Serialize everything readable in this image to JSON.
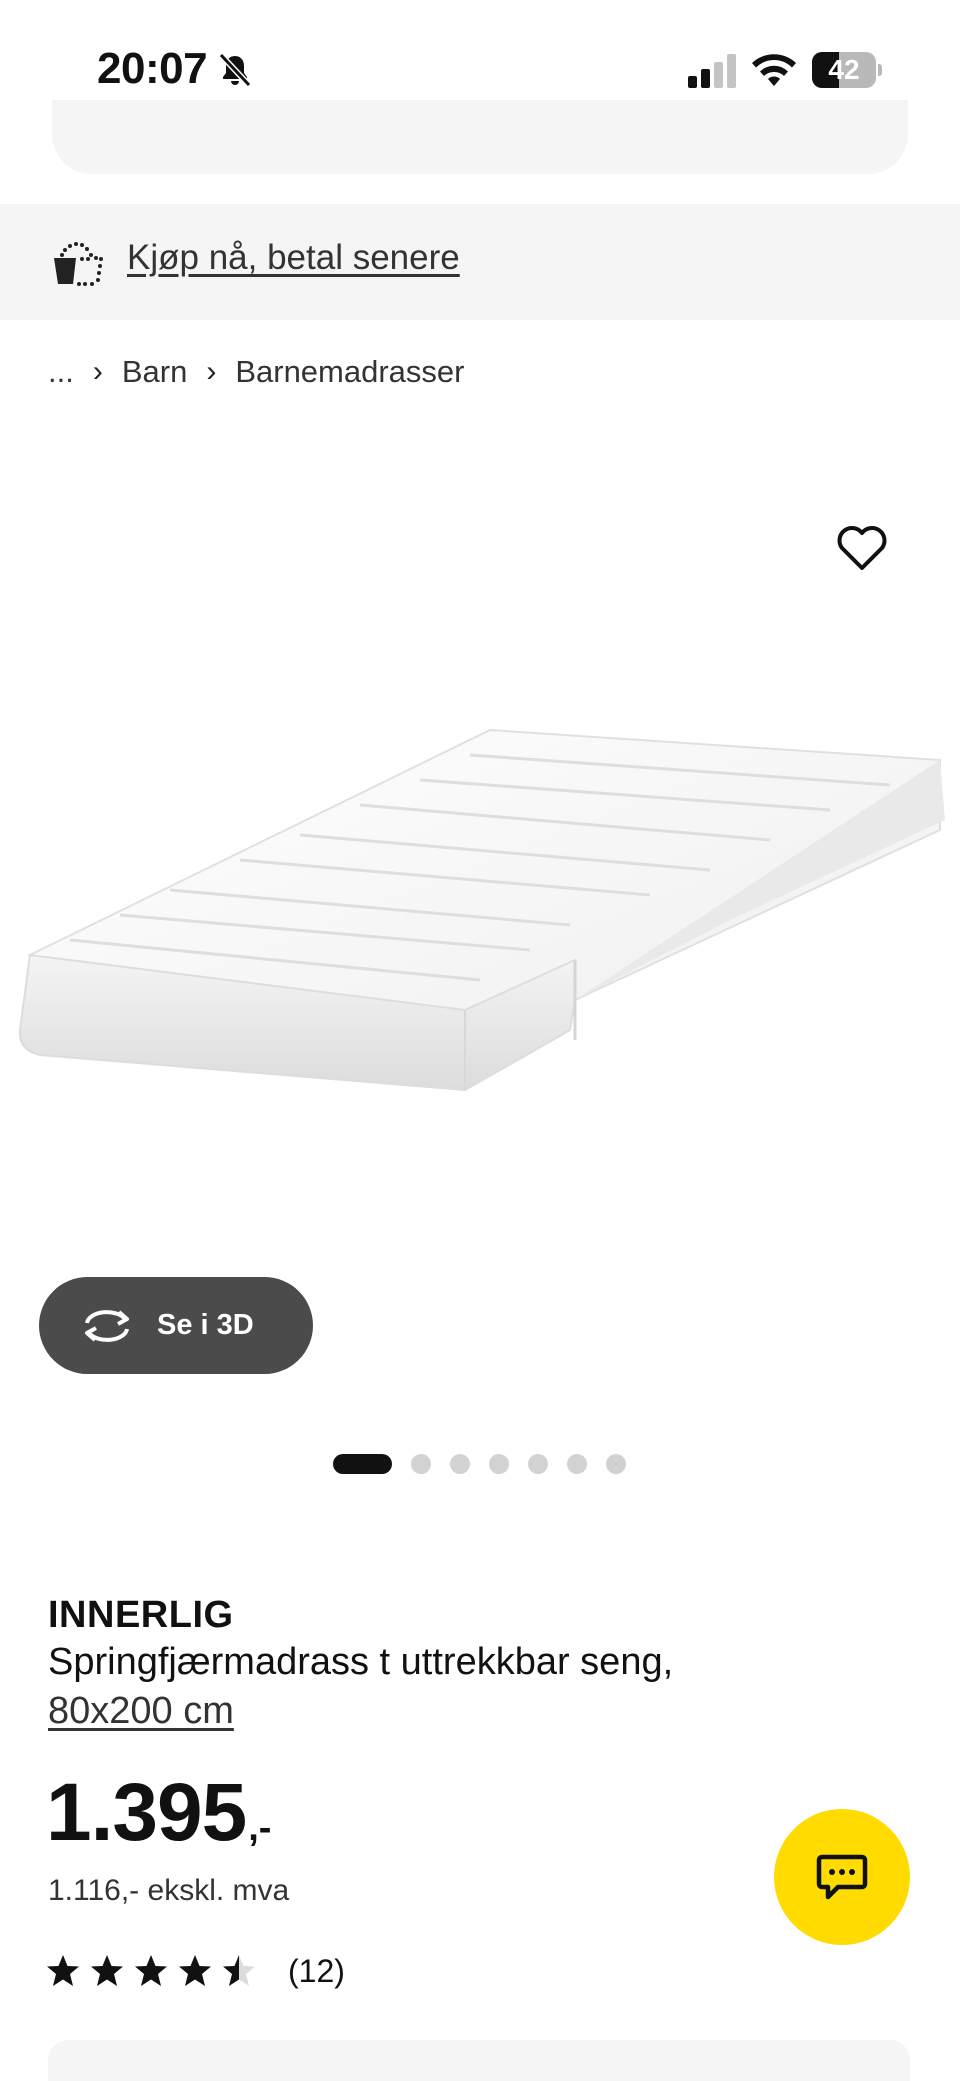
{
  "status_bar": {
    "time": "20:07",
    "battery_level": "42",
    "battery_fraction": 0.42
  },
  "promo": {
    "label": "Kjøp nå, betal senere",
    "icon": "bag-dotted-icon"
  },
  "breadcrumb": {
    "ellipsis": "...",
    "items": [
      "Barn",
      "Barnemadrasser"
    ],
    "separator": "›"
  },
  "gallery": {
    "view_3d_label": "Se i 3D",
    "dot_count": 7,
    "active_index": 0
  },
  "product": {
    "brand": "INNERLIG",
    "description": "Springfjærmadrass t uttrekkbar seng,",
    "size": "80x200 cm",
    "price": "1.395",
    "price_suffix": ",-",
    "price_ex_vat": "1.116,- ekskl. mva",
    "rating": 4.5,
    "rating_max": 5,
    "rating_count": "(12)"
  },
  "colors": {
    "accent_yellow": "#ffdb00",
    "button_dark": "#4b4b4b",
    "banner_bg": "#f5f5f5"
  }
}
